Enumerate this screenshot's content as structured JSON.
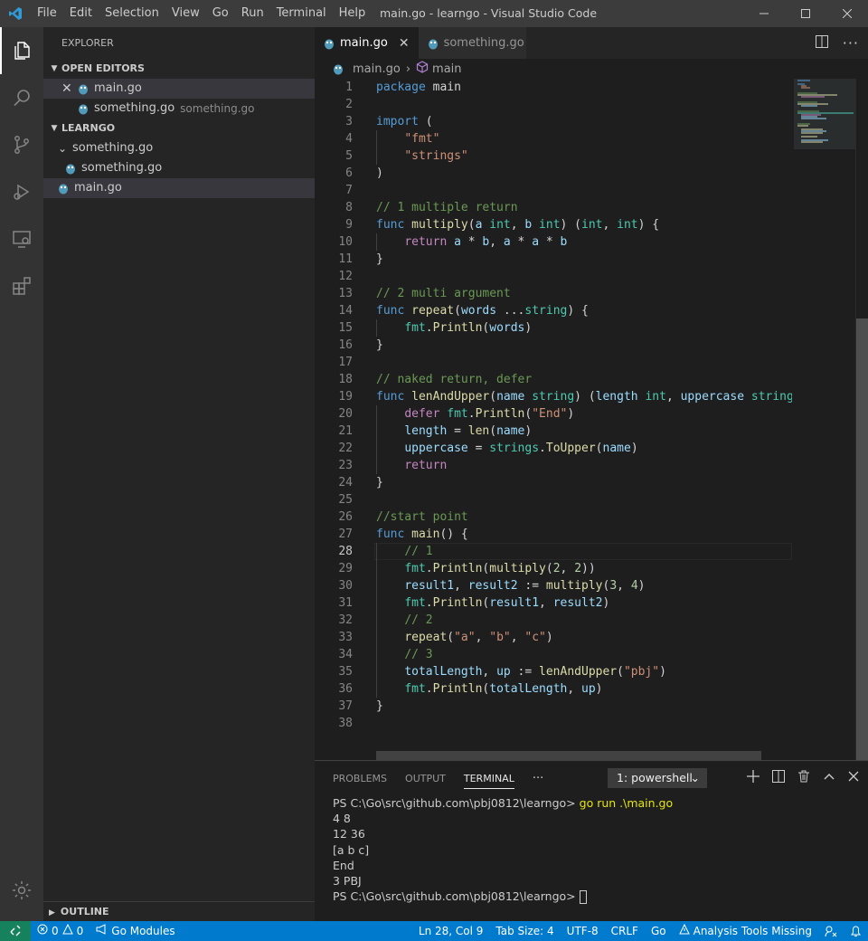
{
  "titlebar": {
    "title": "main.go - learngo - Visual Studio Code",
    "menu": [
      "File",
      "Edit",
      "Selection",
      "View",
      "Go",
      "Run",
      "Terminal",
      "Help"
    ]
  },
  "sidebar": {
    "title": "EXPLORER",
    "open_editors_label": "OPEN EDITORS",
    "open_editors": [
      {
        "name": "main.go",
        "detail": ""
      },
      {
        "name": "something.go",
        "detail": "something.go"
      }
    ],
    "workspace_label": "LEARNGO",
    "folder": "something.go",
    "folder_file": "something.go",
    "root_file": "main.go",
    "outline_label": "OUTLINE"
  },
  "tabs": [
    {
      "label": "main.go"
    },
    {
      "label": "something.go"
    }
  ],
  "breadcrumb": {
    "file": "main.go",
    "symbol": "main"
  },
  "editor": {
    "cursor_line": 28,
    "lines": [
      [
        [
          "kw",
          "package"
        ],
        [
          "pl",
          " main"
        ]
      ],
      [],
      [
        [
          "kw",
          "import"
        ],
        [
          "pl",
          " ("
        ]
      ],
      [
        [
          "pl",
          "    "
        ],
        [
          "str",
          "\"fmt\""
        ]
      ],
      [
        [
          "pl",
          "    "
        ],
        [
          "str",
          "\"strings\""
        ]
      ],
      [
        [
          "pl",
          ")"
        ]
      ],
      [],
      [
        [
          "cm",
          "// 1 multiple return"
        ]
      ],
      [
        [
          "kw",
          "func"
        ],
        [
          "pl",
          " "
        ],
        [
          "fn",
          "multiply"
        ],
        [
          "pl",
          "("
        ],
        [
          "vr",
          "a"
        ],
        [
          "pl",
          " "
        ],
        [
          "ty",
          "int"
        ],
        [
          "pl",
          ", "
        ],
        [
          "vr",
          "b"
        ],
        [
          "pl",
          " "
        ],
        [
          "ty",
          "int"
        ],
        [
          "pl",
          ") ("
        ],
        [
          "ty",
          "int"
        ],
        [
          "pl",
          ", "
        ],
        [
          "ty",
          "int"
        ],
        [
          "pl",
          ") {"
        ]
      ],
      [
        [
          "pl",
          "    "
        ],
        [
          "kw2",
          "return"
        ],
        [
          "pl",
          " "
        ],
        [
          "vr",
          "a"
        ],
        [
          "pl",
          " * "
        ],
        [
          "vr",
          "b"
        ],
        [
          "pl",
          ", "
        ],
        [
          "vr",
          "a"
        ],
        [
          "pl",
          " * "
        ],
        [
          "vr",
          "a"
        ],
        [
          "pl",
          " * "
        ],
        [
          "vr",
          "b"
        ]
      ],
      [
        [
          "pl",
          "}"
        ]
      ],
      [],
      [
        [
          "cm",
          "// 2 multi argument"
        ]
      ],
      [
        [
          "kw",
          "func"
        ],
        [
          "pl",
          " "
        ],
        [
          "fn",
          "repeat"
        ],
        [
          "pl",
          "("
        ],
        [
          "vr",
          "words"
        ],
        [
          "pl",
          " ..."
        ],
        [
          "ty",
          "string"
        ],
        [
          "pl",
          ") {"
        ]
      ],
      [
        [
          "pl",
          "    "
        ],
        [
          "ty",
          "fmt"
        ],
        [
          "pl",
          "."
        ],
        [
          "fn",
          "Println"
        ],
        [
          "pl",
          "("
        ],
        [
          "vr",
          "words"
        ],
        [
          "pl",
          ")"
        ]
      ],
      [
        [
          "pl",
          "}"
        ]
      ],
      [],
      [
        [
          "cm",
          "// naked return, defer"
        ]
      ],
      [
        [
          "kw",
          "func"
        ],
        [
          "pl",
          " "
        ],
        [
          "fn",
          "lenAndUpper"
        ],
        [
          "pl",
          "("
        ],
        [
          "vr",
          "name"
        ],
        [
          "pl",
          " "
        ],
        [
          "ty",
          "string"
        ],
        [
          "pl",
          ") ("
        ],
        [
          "vr",
          "length"
        ],
        [
          "pl",
          " "
        ],
        [
          "ty",
          "int"
        ],
        [
          "pl",
          ", "
        ],
        [
          "vr",
          "uppercase"
        ],
        [
          "pl",
          " "
        ],
        [
          "ty",
          "string"
        ],
        [
          "pl",
          ")"
        ]
      ],
      [
        [
          "pl",
          "    "
        ],
        [
          "kw2",
          "defer"
        ],
        [
          "pl",
          " "
        ],
        [
          "ty",
          "fmt"
        ],
        [
          "pl",
          "."
        ],
        [
          "fn",
          "Println"
        ],
        [
          "pl",
          "("
        ],
        [
          "str",
          "\"End\""
        ],
        [
          "pl",
          ")"
        ]
      ],
      [
        [
          "pl",
          "    "
        ],
        [
          "vr",
          "length"
        ],
        [
          "pl",
          " = "
        ],
        [
          "fn",
          "len"
        ],
        [
          "pl",
          "("
        ],
        [
          "vr",
          "name"
        ],
        [
          "pl",
          ")"
        ]
      ],
      [
        [
          "pl",
          "    "
        ],
        [
          "vr",
          "uppercase"
        ],
        [
          "pl",
          " = "
        ],
        [
          "ty",
          "strings"
        ],
        [
          "pl",
          "."
        ],
        [
          "fn",
          "ToUpper"
        ],
        [
          "pl",
          "("
        ],
        [
          "vr",
          "name"
        ],
        [
          "pl",
          ")"
        ]
      ],
      [
        [
          "pl",
          "    "
        ],
        [
          "kw2",
          "return"
        ]
      ],
      [
        [
          "pl",
          "}"
        ]
      ],
      [],
      [
        [
          "cm",
          "//start point"
        ]
      ],
      [
        [
          "kw",
          "func"
        ],
        [
          "pl",
          " "
        ],
        [
          "fn",
          "main"
        ],
        [
          "pl",
          "() {"
        ]
      ],
      [
        [
          "pl",
          "    "
        ],
        [
          "cm",
          "// 1"
        ]
      ],
      [
        [
          "pl",
          "    "
        ],
        [
          "ty",
          "fmt"
        ],
        [
          "pl",
          "."
        ],
        [
          "fn",
          "Println"
        ],
        [
          "pl",
          "("
        ],
        [
          "fn",
          "multiply"
        ],
        [
          "pl",
          "("
        ],
        [
          "num",
          "2"
        ],
        [
          "pl",
          ", "
        ],
        [
          "num",
          "2"
        ],
        [
          "pl",
          "))"
        ]
      ],
      [
        [
          "pl",
          "    "
        ],
        [
          "vr",
          "result1"
        ],
        [
          "pl",
          ", "
        ],
        [
          "vr",
          "result2"
        ],
        [
          "pl",
          " := "
        ],
        [
          "fn",
          "multiply"
        ],
        [
          "pl",
          "("
        ],
        [
          "num",
          "3"
        ],
        [
          "pl",
          ", "
        ],
        [
          "num",
          "4"
        ],
        [
          "pl",
          ")"
        ]
      ],
      [
        [
          "pl",
          "    "
        ],
        [
          "ty",
          "fmt"
        ],
        [
          "pl",
          "."
        ],
        [
          "fn",
          "Println"
        ],
        [
          "pl",
          "("
        ],
        [
          "vr",
          "result1"
        ],
        [
          "pl",
          ", "
        ],
        [
          "vr",
          "result2"
        ],
        [
          "pl",
          ")"
        ]
      ],
      [
        [
          "pl",
          "    "
        ],
        [
          "cm",
          "// 2"
        ]
      ],
      [
        [
          "pl",
          "    "
        ],
        [
          "fn",
          "repeat"
        ],
        [
          "pl",
          "("
        ],
        [
          "str",
          "\"a\""
        ],
        [
          "pl",
          ", "
        ],
        [
          "str",
          "\"b\""
        ],
        [
          "pl",
          ", "
        ],
        [
          "str",
          "\"c\""
        ],
        [
          "pl",
          ")"
        ]
      ],
      [
        [
          "pl",
          "    "
        ],
        [
          "cm",
          "// 3"
        ]
      ],
      [
        [
          "pl",
          "    "
        ],
        [
          "vr",
          "totalLength"
        ],
        [
          "pl",
          ", "
        ],
        [
          "vr",
          "up"
        ],
        [
          "pl",
          " := "
        ],
        [
          "fn",
          "lenAndUpper"
        ],
        [
          "pl",
          "("
        ],
        [
          "str",
          "\"pbj\""
        ],
        [
          "pl",
          ")"
        ]
      ],
      [
        [
          "pl",
          "    "
        ],
        [
          "ty",
          "fmt"
        ],
        [
          "pl",
          "."
        ],
        [
          "fn",
          "Println"
        ],
        [
          "pl",
          "("
        ],
        [
          "vr",
          "totalLength"
        ],
        [
          "pl",
          ", "
        ],
        [
          "vr",
          "up"
        ],
        [
          "pl",
          ")"
        ]
      ],
      [
        [
          "pl",
          "}"
        ]
      ],
      []
    ]
  },
  "panel": {
    "tabs": [
      "PROBLEMS",
      "OUTPUT",
      "TERMINAL"
    ],
    "active_tab": "TERMINAL",
    "more": "···",
    "dropdown": "1: powershell",
    "terminal": [
      {
        "prompt": "PS C:\\Go\\src\\github.com\\pbj0812\\learngo> ",
        "cmd": "go run .\\main.go"
      },
      {
        "text": "4 8"
      },
      {
        "text": "12 36"
      },
      {
        "text": "[a b c]"
      },
      {
        "text": "End"
      },
      {
        "text": "3 PBJ"
      },
      {
        "prompt": "PS C:\\Go\\src\\github.com\\pbj0812\\learngo> ",
        "cmd": "",
        "cursor": true
      }
    ]
  },
  "statusbar": {
    "errors": "0",
    "warnings": "0",
    "go_modules": "Go Modules",
    "position": "Ln 28, Col 9",
    "tab_size": "Tab Size: 4",
    "encoding": "UTF-8",
    "eol": "CRLF",
    "language": "Go",
    "analysis": "Analysis Tools Missing"
  },
  "colors": {
    "accent": "#007acc",
    "remote": "#16825d",
    "titlebar": "#3c3c3c"
  }
}
